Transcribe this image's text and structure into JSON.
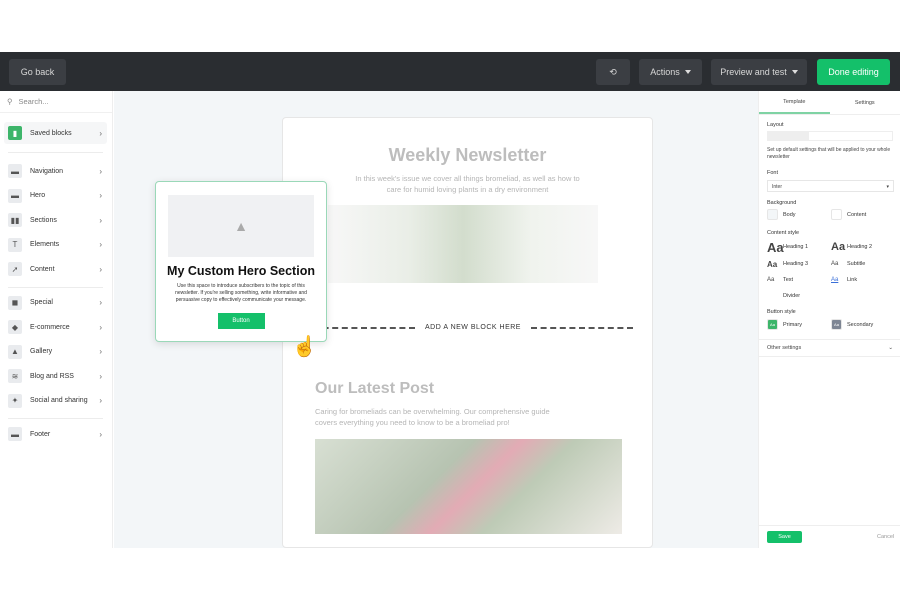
{
  "topbar": {
    "go_back": "Go back",
    "history_icon": "history-icon",
    "actions": "Actions",
    "preview": "Preview and test",
    "done": "Done editing"
  },
  "sidebar": {
    "search_placeholder": "Search...",
    "saved": "Saved blocks",
    "groups": [
      [
        "Navigation",
        "Hero",
        "Sections",
        "Elements",
        "Content"
      ],
      [
        "Special",
        "E-commerce",
        "Gallery",
        "Blog and RSS",
        "Social and sharing"
      ],
      [
        "Footer"
      ]
    ]
  },
  "email": {
    "title": "Weekly Newsletter",
    "intro": "In this week's issue we cover all things bromeliad, as well as how to care for humid loving plants in a dry environment",
    "drop": "ADD A NEW BLOCK HERE",
    "post_title": "Our Latest Post",
    "post_text": "Caring for bromeliads can be overwhelming. Our comprehensive guide covers everything you need to know to be a bromeliad pro!"
  },
  "drag": {
    "title": "My Custom Hero Section",
    "text": "Use this space to introduce subscribers to the topic of this newsletter. If you're selling something, write informative and persuasive copy to effectively communicate your message.",
    "button": "Button"
  },
  "panel": {
    "tabs": [
      "Template",
      "Settings"
    ],
    "layout": "Layout",
    "desc": "Set up default settings that will be applied to your whole newsletter",
    "font_label": "Font",
    "font_value": "Inter",
    "background": "Background",
    "body": "Body",
    "content": "Content",
    "content_style": "Content style",
    "styles": [
      "Heading 1",
      "Heading 2",
      "Heading 3",
      "Subtitle",
      "Text",
      "Link",
      "Divider"
    ],
    "button_style": "Button style",
    "primary": "Primary",
    "secondary": "Secondary",
    "other": "Other settings",
    "save": "Save",
    "cancel": "Cancel"
  },
  "colors": {
    "accent": "#14c06a",
    "topbar": "#2a2d31",
    "secondary": "#7d8593"
  }
}
